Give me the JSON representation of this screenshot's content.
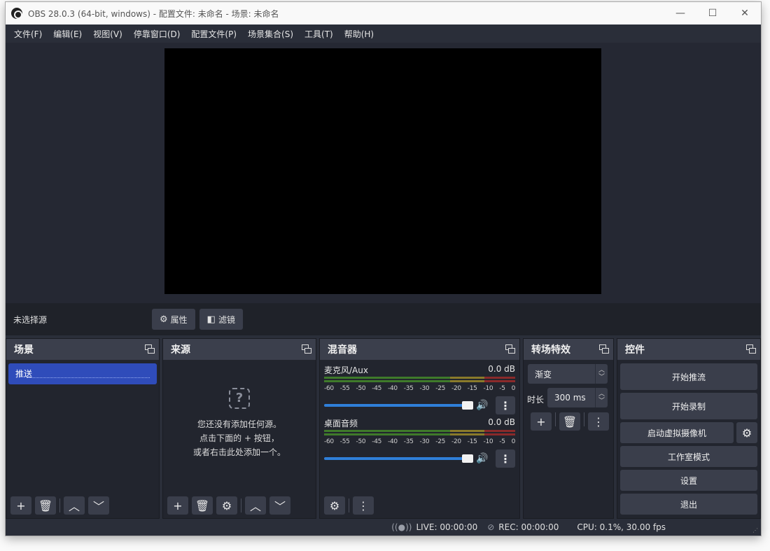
{
  "window": {
    "title": "OBS 28.0.3 (64-bit, windows) - 配置文件: 未命名 - 场景: 未命名",
    "controls": {
      "minimize": "—",
      "maximize": "☐",
      "close": "✕"
    }
  },
  "menubar": {
    "items": [
      "文件(F)",
      "编辑(E)",
      "视图(V)",
      "停靠窗口(D)",
      "配置文件(P)",
      "场景集合(S)",
      "工具(T)",
      "帮助(H)"
    ]
  },
  "sourcebar": {
    "no_selection": "未选择源",
    "properties": "属性",
    "filters": "滤镜"
  },
  "scenes": {
    "title": "场景",
    "items": [
      "推送"
    ]
  },
  "sources": {
    "title": "来源",
    "empty_line1": "您还没有添加任何源。",
    "empty_line2": "点击下面的 + 按钮，",
    "empty_line3": "或者右击此处添加一个。"
  },
  "mixer": {
    "title": "混音器",
    "channels": [
      {
        "name": "麦克风/Aux",
        "db": "0.0 dB",
        "level": 0
      },
      {
        "name": "桌面音频",
        "db": "0.0 dB",
        "level": 0
      }
    ],
    "ticks": [
      "-60",
      "-55",
      "-50",
      "-45",
      "-40",
      "-35",
      "-30",
      "-25",
      "-20",
      "-15",
      "-10",
      "-5",
      "0"
    ]
  },
  "transitions": {
    "title": "转场特效",
    "selected": "渐变",
    "duration_label": "时长",
    "duration_value": "300 ms"
  },
  "controls": {
    "title": "控件",
    "start_streaming": "开始推流",
    "start_recording": "开始录制",
    "start_virtual_cam": "启动虚拟摄像机",
    "studio_mode": "工作室模式",
    "settings": "设置",
    "exit": "退出"
  },
  "status": {
    "live": "LIVE: 00:00:00",
    "rec": "REC: 00:00:00",
    "cpu": "CPU: 0.1%, 30.00 fps"
  },
  "colors": {
    "accent": "#2f4cba",
    "volume": "#2f7fd9",
    "panel": "#2a2e39",
    "dock_header": "#3b3f4c"
  }
}
